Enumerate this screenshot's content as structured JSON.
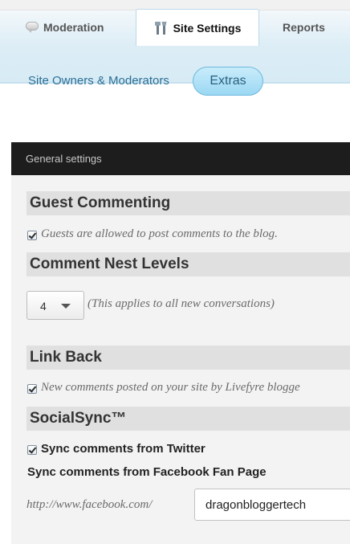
{
  "tabs": {
    "moderation": {
      "label": "Moderation",
      "icon": "speech-bubble-icon"
    },
    "site_settings": {
      "label": "Site Settings",
      "icon": "tools-icon",
      "active": true
    },
    "reports": {
      "label": "Reports"
    }
  },
  "subnav": {
    "site_owners": "Site Owners & Moderators",
    "extras": "Extras"
  },
  "panel": {
    "header": "General settings",
    "guest_commenting": {
      "heading": "Guest Commenting",
      "checkbox_label": "Guests are allowed to post comments to the blog.",
      "checked": true
    },
    "nest_levels": {
      "heading": "Comment Nest Levels",
      "selected": "4",
      "note": "(This applies to all new conversations)"
    },
    "link_back": {
      "heading": "Link Back",
      "checkbox_label": "New comments posted on your site by Livefyre blogge",
      "checked": true
    },
    "socialsync": {
      "heading": "SocialSync™",
      "twitter_label": "Sync comments from Twitter",
      "twitter_checked": true,
      "facebook_label": "Sync comments from Facebook Fan Page",
      "facebook_prefix": "http://www.facebook.com/",
      "facebook_value": "dragonbloggertech"
    }
  },
  "colors": {
    "accent": "#2a6f96",
    "panel_header": "#1d1d1d",
    "section_bg": "#e0e0e0",
    "extras_bg": "#9bd8f3"
  }
}
